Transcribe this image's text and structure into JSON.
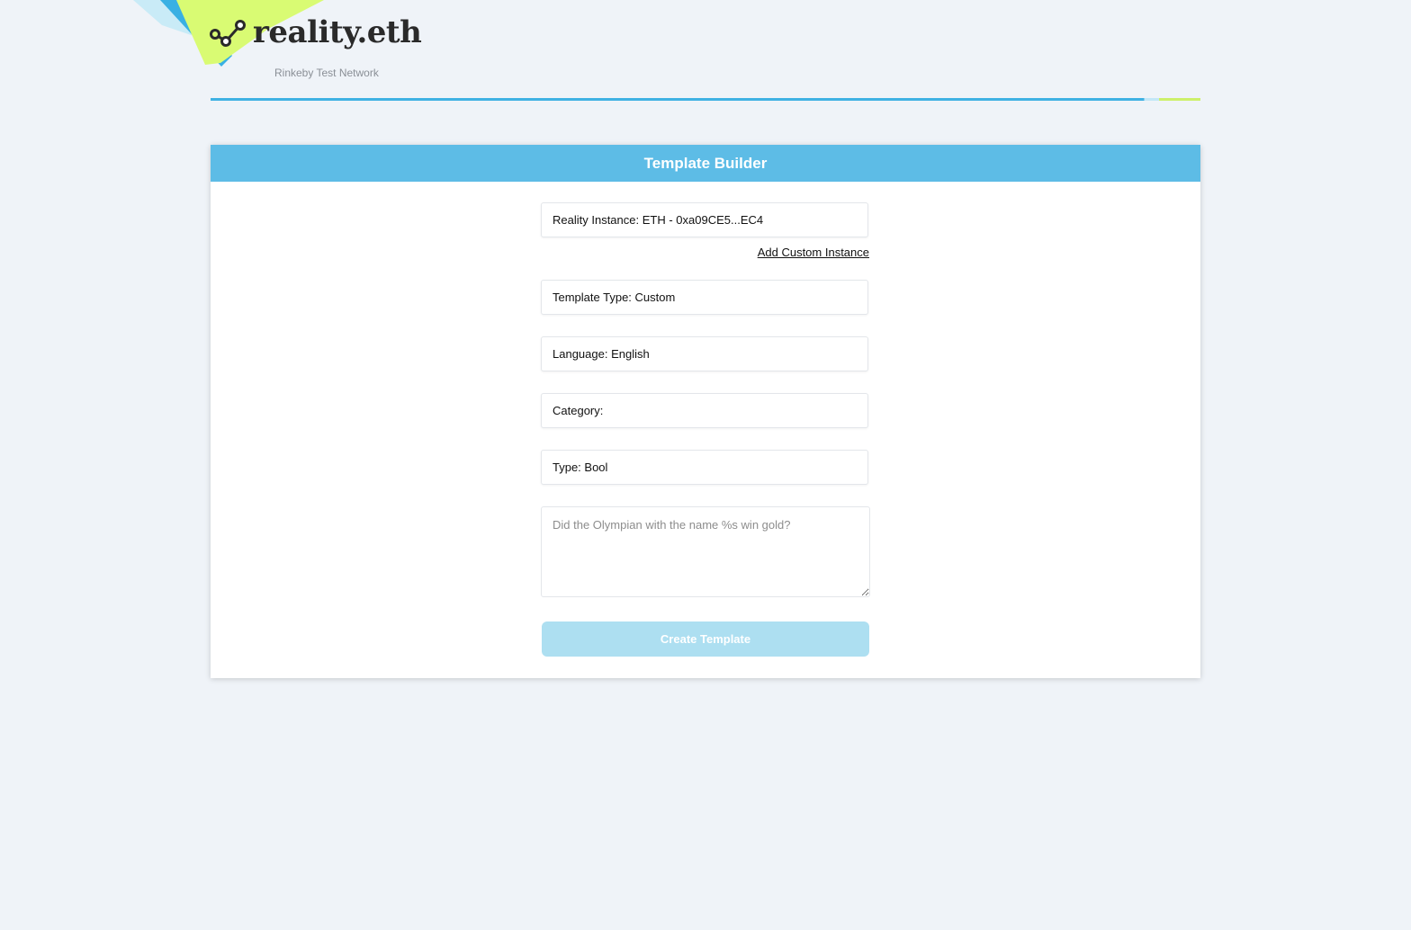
{
  "brand": {
    "name": "reality.eth",
    "network": "Rinkeby Test Network",
    "logo_icon": "link-nodes-icon",
    "colors": {
      "accent": "#5dbce6",
      "rule_blue": "#3fb1e3",
      "lime": "#cdf06a",
      "background": "#eff3f8"
    }
  },
  "panel": {
    "title": "Template Builder",
    "fields": {
      "instance": "Reality Instance: ETH - 0xa09CE5...EC4",
      "template_type": "Template Type: Custom",
      "language": "Language: English",
      "category": "Category:",
      "type": "Type: Bool"
    },
    "add_custom_instance": "Add Custom Instance",
    "question_placeholder": "Did the Olympian with the name %s win gold?",
    "create_button": "Create Template"
  }
}
